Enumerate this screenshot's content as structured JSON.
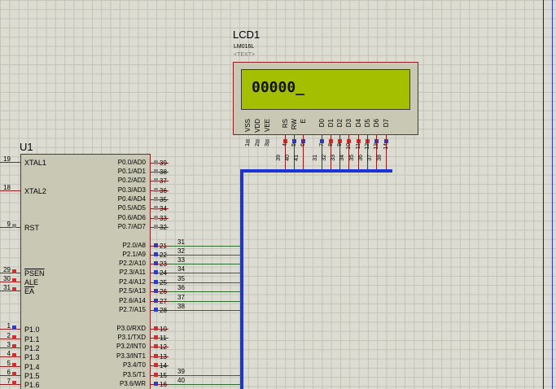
{
  "lcd": {
    "ref": "LCD1",
    "model": "LM016L",
    "text_tag": "<TEXT>",
    "display_text": "00000_",
    "pin_labels": [
      "VSS",
      "VDD",
      "VEE",
      "RS",
      "RW",
      "E",
      "D0",
      "D1",
      "D2",
      "D3",
      "D4",
      "D5",
      "D6",
      "D7"
    ],
    "pin_numbers": [
      "1",
      "2",
      "3",
      "4",
      "5",
      "6",
      "7",
      "8",
      "9",
      "10",
      "11",
      "12",
      "13",
      "14"
    ],
    "net_labels": [
      "39",
      "40",
      "41",
      "31",
      "32",
      "33",
      "34",
      "35",
      "36",
      "37",
      "38"
    ],
    "colors": {
      "screen": "#a4be00",
      "bezel": "#c8c8b4",
      "border": "#8a2020"
    }
  },
  "mcu": {
    "ref": "U1",
    "left_pins": [
      {
        "num": "19",
        "label": "XTAL1"
      },
      {
        "num": "18",
        "label": "XTAL2"
      },
      {
        "num": "9",
        "label": "RST"
      },
      {
        "num": "29",
        "label": "PSEN"
      },
      {
        "num": "30",
        "label": "ALE"
      },
      {
        "num": "31",
        "label": "EA"
      },
      {
        "num": "1",
        "label": "P1.0"
      },
      {
        "num": "2",
        "label": "P1.1"
      },
      {
        "num": "3",
        "label": "P1.2"
      },
      {
        "num": "4",
        "label": "P1.3"
      },
      {
        "num": "5",
        "label": "P1.4"
      },
      {
        "num": "6",
        "label": "P1.5"
      },
      {
        "num": "7",
        "label": "P1.6"
      }
    ],
    "right_pins": [
      {
        "num": "39",
        "label": "P0.0/AD0"
      },
      {
        "num": "38",
        "label": "P0.1/AD1"
      },
      {
        "num": "37",
        "label": "P0.2/AD2"
      },
      {
        "num": "36",
        "label": "P0.3/AD3"
      },
      {
        "num": "35",
        "label": "P0.4/AD4"
      },
      {
        "num": "34",
        "label": "P0.5/AD5"
      },
      {
        "num": "33",
        "label": "P0.6/AD6"
      },
      {
        "num": "32",
        "label": "P0.7/AD7"
      },
      {
        "num": "21",
        "label": "P2.0/A8",
        "net": "31"
      },
      {
        "num": "22",
        "label": "P2.1/A9",
        "net": "32"
      },
      {
        "num": "23",
        "label": "P2.2/A10",
        "net": "33"
      },
      {
        "num": "24",
        "label": "P2.3/A11",
        "net": "34"
      },
      {
        "num": "25",
        "label": "P2.4/A12",
        "net": "35"
      },
      {
        "num": "26",
        "label": "P2.5/A13",
        "net": "36"
      },
      {
        "num": "27",
        "label": "P2.6/A14",
        "net": "37"
      },
      {
        "num": "28",
        "label": "P2.7/A15",
        "net": "38"
      },
      {
        "num": "10",
        "label": "P3.0/RXD"
      },
      {
        "num": "11",
        "label": "P3.1/TXD"
      },
      {
        "num": "12",
        "label": "P3.2/INT0"
      },
      {
        "num": "13",
        "label": "P3.3/INT1"
      },
      {
        "num": "14",
        "label": "P3.4/T0"
      },
      {
        "num": "15",
        "label": "P3.5/T1",
        "net": "39"
      },
      {
        "num": "16",
        "label": "P3.6/WR",
        "net": "40"
      }
    ]
  },
  "colors": {
    "bus": "#1d34d4",
    "wire": "#2f6a2f",
    "pin_red": "#e02828",
    "pin_blue": "#2a3ad8"
  }
}
